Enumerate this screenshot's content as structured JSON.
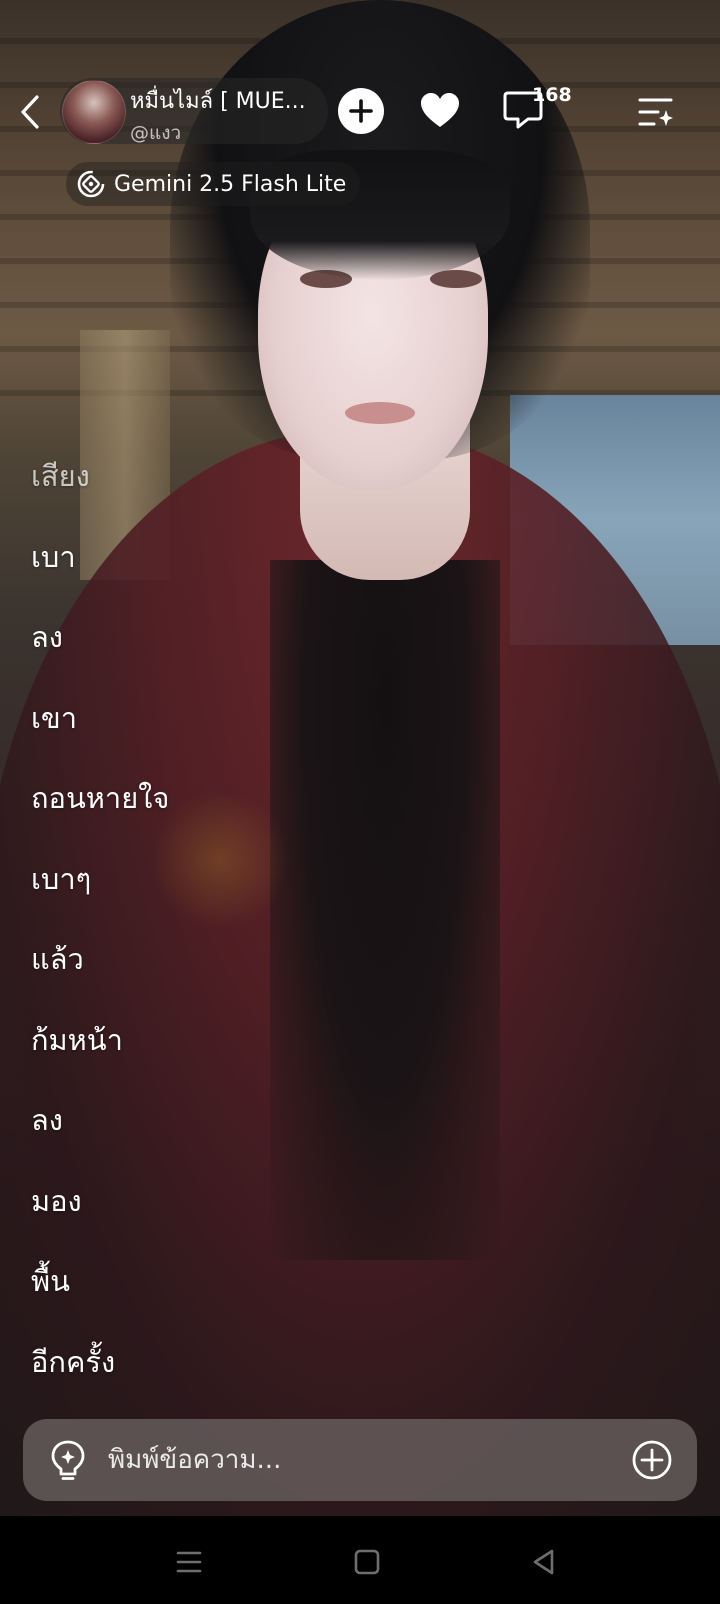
{
  "header": {
    "character_name": "หมื่นไมล์ [ MUE...",
    "character_handle": "@แงว",
    "comment_count": "168",
    "model_name": "Gemini 2.5 Flash Lite",
    "icons": {
      "back": "chevron-left-icon",
      "add": "plus-circle-icon",
      "like": "heart-icon",
      "comments": "speech-bubble-icon",
      "menu": "list-sparkle-icon",
      "model": "gemini-model-icon"
    }
  },
  "message": {
    "words": [
      "เสียง",
      "เบา",
      "ลง",
      "เขา",
      "ถอนหายใจ",
      "เบาๆ",
      "แล้ว",
      "ก้มหน้า",
      "ลง",
      "มอง",
      "พื้น",
      "อีกครั้ง"
    ]
  },
  "composer": {
    "placeholder": "พิมพ์ข้อความ...",
    "value": "",
    "icons": {
      "idea": "lightbulb-icon",
      "attach": "plus-circle-icon"
    }
  },
  "system_nav": {
    "icons": [
      "recents-icon",
      "home-icon",
      "back-icon"
    ]
  },
  "colors": {
    "accent": "#ffffff",
    "input_bg": "#6e6464",
    "shirt": "#6e262c"
  }
}
